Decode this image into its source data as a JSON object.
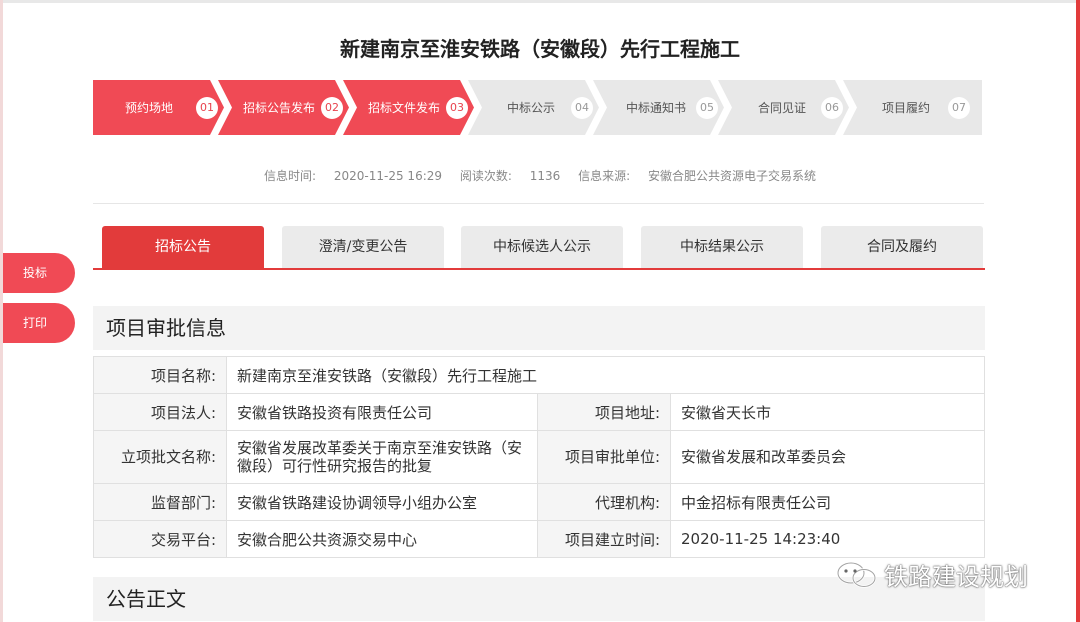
{
  "page": {
    "title": "新建南京至淮安铁路（安徽段）先行工程施工"
  },
  "steps": [
    {
      "label": "预约场地",
      "num": "01",
      "active": true
    },
    {
      "label": "招标公告发布",
      "num": "02",
      "active": true
    },
    {
      "label": "招标文件发布",
      "num": "03",
      "active": true
    },
    {
      "label": "中标公示",
      "num": "04",
      "active": false
    },
    {
      "label": "中标通知书",
      "num": "05",
      "active": false
    },
    {
      "label": "合同见证",
      "num": "06",
      "active": false
    },
    {
      "label": "项目履约",
      "num": "07",
      "active": false
    }
  ],
  "info": {
    "time_label": "信息时间:",
    "time_value": "2020-11-25 16:29",
    "reads_label": "阅读次数:",
    "reads_value": "1136",
    "source_label": "信息来源:",
    "source_value": "安徽合肥公共资源电子交易系统"
  },
  "tabs": [
    {
      "label": "招标公告",
      "active": true
    },
    {
      "label": "澄清/变更公告",
      "active": false
    },
    {
      "label": "中标候选人公示",
      "active": false
    },
    {
      "label": "中标结果公示",
      "active": false
    },
    {
      "label": "合同及履约",
      "active": false
    }
  ],
  "side": {
    "bid_label": "投标",
    "print_label": "打印"
  },
  "sections": {
    "approval_title": "项目审批信息",
    "notice_title": "公告正文"
  },
  "table": {
    "name_label": "项目名称:",
    "name_value": "新建南京至淮安铁路（安徽段）先行工程施工",
    "legal_label": "项目法人:",
    "legal_value": "安徽省铁路投资有限责任公司",
    "address_label": "项目地址:",
    "address_value": "安徽省天长市",
    "approval_doc_label": "立项批文名称:",
    "approval_doc_value": "安徽省发展改革委关于南京至淮安铁路（安徽段）可行性研究报告的批复",
    "approval_unit_label": "项目审批单位:",
    "approval_unit_value": "安徽省发展和改革委员会",
    "supervisor_label": "监督部门:",
    "supervisor_value": "安徽省铁路建设协调领导小组办公室",
    "agent_label": "代理机构:",
    "agent_value": "中金招标有限责任公司",
    "platform_label": "交易平台:",
    "platform_value": "安徽合肥公共资源交易中心",
    "created_label": "项目建立时间:",
    "created_value": "2020-11-25 14:23:40"
  },
  "watermark": {
    "text": "铁路建设规划",
    "icon": "wechat-icon"
  }
}
